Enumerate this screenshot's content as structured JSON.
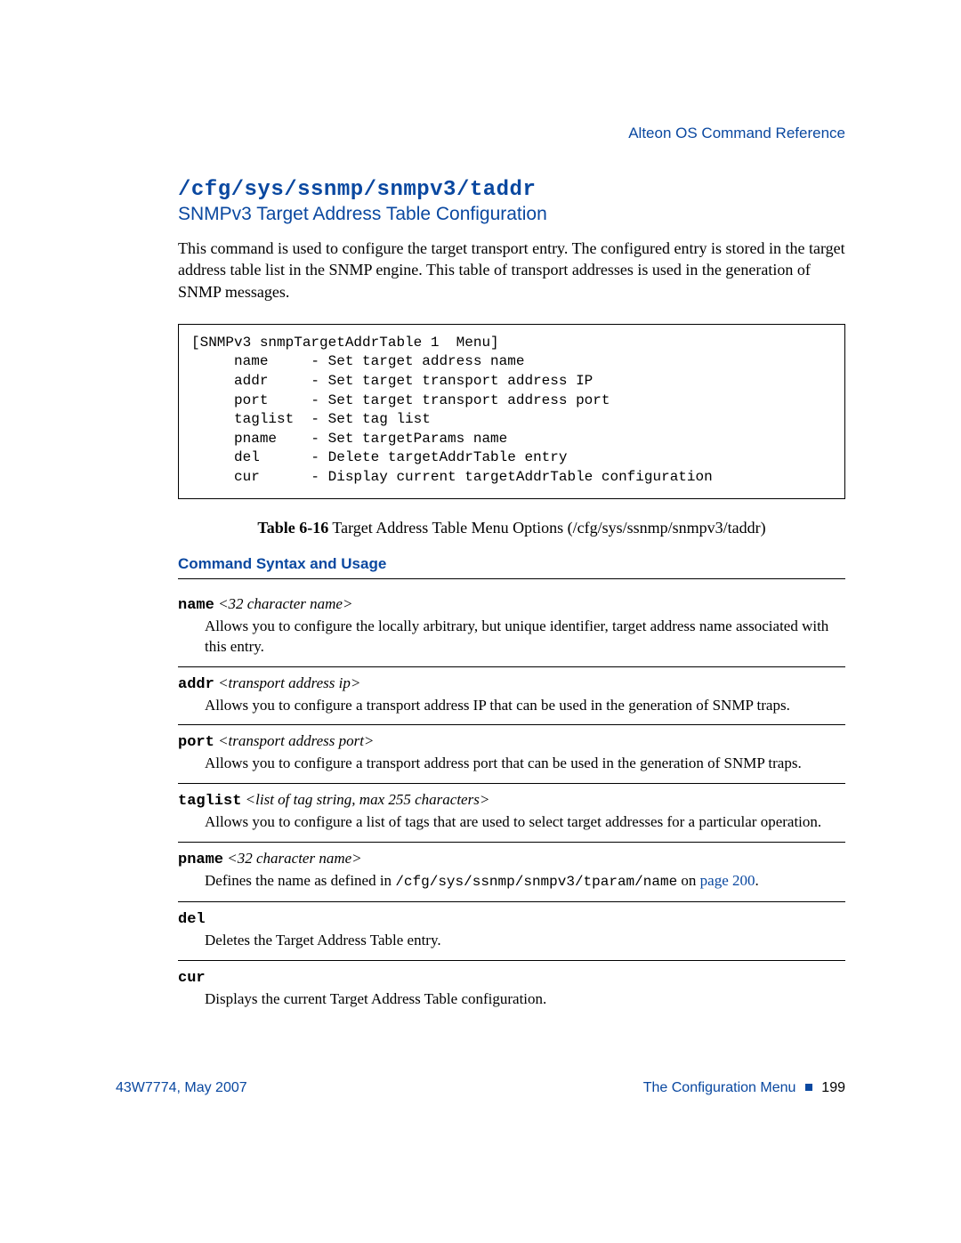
{
  "header": {
    "running": "Alteon OS  Command Reference"
  },
  "section": {
    "title": "/cfg/sys/ssnmp/snmpv3/taddr",
    "subtitle": "SNMPv3 Target Address Table Configuration",
    "intro": "This command is used to configure the target transport entry. The configured entry is stored in the target address table list in the SNMP engine. This table of transport addresses is used in the generation of SNMP messages."
  },
  "menu_block": "[SNMPv3 snmpTargetAddrTable 1  Menu]\n     name     - Set target address name\n     addr     - Set target transport address IP\n     port     - Set target transport address port\n     taglist  - Set tag list\n     pname    - Set targetParams name\n     del      - Delete targetAddrTable entry\n     cur      - Display current targetAddrTable configuration",
  "table": {
    "label": "Table 6-16",
    "caption": "  Target Address Table Menu Options (/cfg/sys/ssnmp/snmpv3/taddr)",
    "column_header": "Command Syntax and Usage",
    "rows": [
      {
        "cmd": "name",
        "param": "<32 character name>",
        "desc_pre": "Allows you to configure the locally arbitrary, but unique identifier, target address name associated with this entry.",
        "code": "",
        "desc_post": "",
        "link": ""
      },
      {
        "cmd": "addr",
        "param": "<transport address ip>",
        "desc_pre": "Allows you to configure a transport address IP that can be used in the generation of SNMP traps.",
        "code": "",
        "desc_post": "",
        "link": ""
      },
      {
        "cmd": "port",
        "param": "<transport address port>",
        "desc_pre": "Allows you to configure a transport address port that can be used in the generation of SNMP traps.",
        "code": "",
        "desc_post": "",
        "link": ""
      },
      {
        "cmd": "taglist",
        "param": "<list of tag string, max 255 characters>",
        "desc_pre": "Allows you to configure a list of tags that are used to select target addresses for a particular operation.",
        "code": "",
        "desc_post": "",
        "link": ""
      },
      {
        "cmd": "pname",
        "param": "<32 character name>",
        "desc_pre": "Defines the name as defined in ",
        "code": "/cfg/sys/ssnmp/snmpv3/tparam/name",
        "desc_post": " on ",
        "link": "page 200"
      },
      {
        "cmd": "del",
        "param": "",
        "desc_pre": "Deletes the Target Address Table entry.",
        "code": "",
        "desc_post": "",
        "link": ""
      },
      {
        "cmd": "cur",
        "param": "",
        "desc_pre": "Displays the current Target Address Table configuration.",
        "code": "",
        "desc_post": "",
        "link": ""
      }
    ]
  },
  "footer": {
    "left": "43W7774, May 2007",
    "right_label": "The Configuration Menu",
    "page_no": "199"
  }
}
